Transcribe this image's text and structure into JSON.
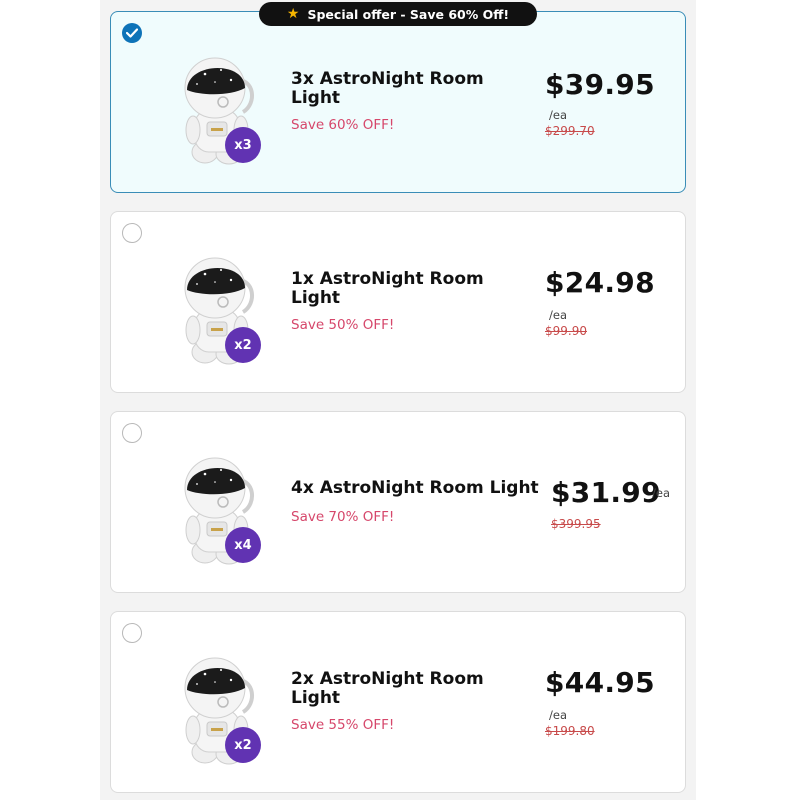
{
  "banner": {
    "icon": "star-icon",
    "text": "Special offer - Save 60% Off!"
  },
  "colors": {
    "selected_border": "#3a8db7",
    "selected_bg": "#f0fcfd",
    "radio_checked": "#0e73b8",
    "badge": "#6133b2",
    "save_text": "#d6476b",
    "old_price": "#c84b4b"
  },
  "offers": [
    {
      "selected": true,
      "badge": "x3",
      "title": "3x AstroNight Room Light",
      "save": "Save 60% OFF!",
      "price": "$39.95",
      "per": "/ea",
      "old_price": "$299.70"
    },
    {
      "selected": false,
      "badge": "x2",
      "title": "1x AstroNight Room Light",
      "save": "Save 50% OFF!",
      "price": "$24.98",
      "per": "/ea",
      "old_price": "$99.90"
    },
    {
      "selected": false,
      "badge": "x4",
      "title": "4x AstroNight Room Light",
      "save": "Save 70% OFF!",
      "price": "$31.99",
      "per": "/ea",
      "old_price": "$399.95"
    },
    {
      "selected": false,
      "badge": "x2",
      "title": "2x AstroNight Room Light",
      "save": "Save 55% OFF!",
      "price": "$44.95",
      "per": "/ea",
      "old_price": "$199.80"
    }
  ]
}
